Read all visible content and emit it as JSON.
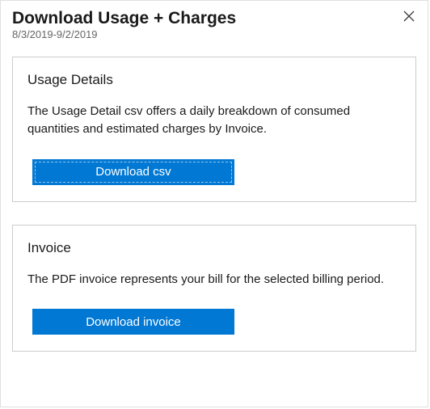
{
  "header": {
    "title": "Download Usage + Charges",
    "date_range": "8/3/2019-9/2/2019"
  },
  "usage_details": {
    "title": "Usage Details",
    "description": "The Usage Detail csv offers a daily breakdown of consumed quantities and estimated charges by Invoice.",
    "button_label": "Download csv"
  },
  "invoice": {
    "title": "Invoice",
    "description": "The PDF invoice represents your bill for the selected billing period.",
    "button_label": "Download invoice"
  }
}
